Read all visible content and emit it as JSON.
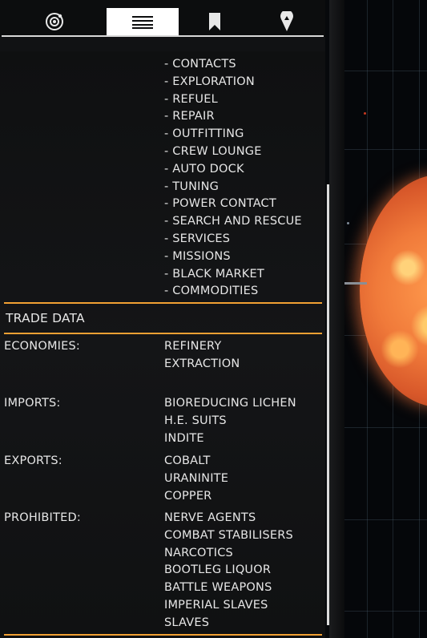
{
  "tabs": [
    {
      "icon": "system-orbit-icon",
      "active": false
    },
    {
      "icon": "list-lines-icon",
      "active": true
    },
    {
      "icon": "bookmark-icon",
      "active": false
    },
    {
      "icon": "location-pin-icon",
      "active": false
    }
  ],
  "services": [
    "- CONTACTS",
    "- EXPLORATION",
    "- REFUEL",
    "- REPAIR",
    "- OUTFITTING",
    "- CREW LOUNGE",
    "- AUTO DOCK",
    "- TUNING",
    "- POWER CONTACT",
    "- SEARCH AND RESCUE",
    "- SERVICES",
    "- MISSIONS",
    "- BLACK MARKET",
    "- COMMODITIES"
  ],
  "trade": {
    "title": "TRADE DATA",
    "economies": {
      "label": "ECONOMIES:",
      "values": [
        "REFINERY",
        "EXTRACTION"
      ]
    },
    "imports": {
      "label": "IMPORTS:",
      "values": [
        "BIOREDUCING LICHEN",
        "H.E. SUITS",
        "INDITE"
      ]
    },
    "exports": {
      "label": "EXPORTS:",
      "values": [
        "COBALT",
        "URANINITE",
        "COPPER"
      ]
    },
    "prohibited": {
      "label": "PROHIBITED:",
      "values": [
        "NERVE AGENTS",
        "COMBAT STABILISERS",
        "NARCOTICS",
        "BOOTLEG LIQUOR",
        "BATTLE WEAPONS",
        "IMPERIAL SLAVES",
        "SLAVES"
      ]
    }
  },
  "colors": {
    "accent": "#f2a033",
    "panel_bg": "#111214",
    "text": "#e6e6e6"
  }
}
